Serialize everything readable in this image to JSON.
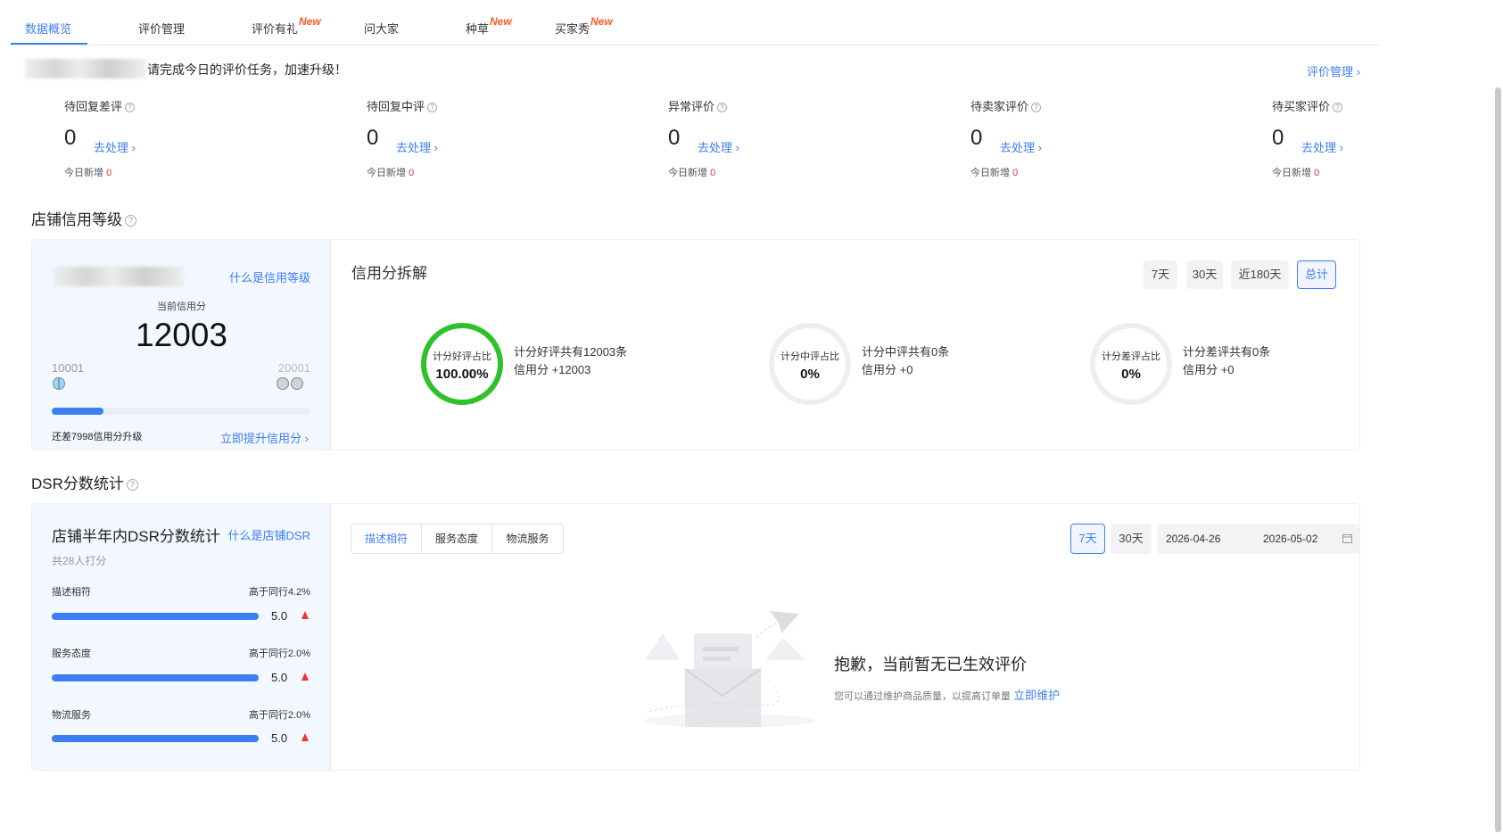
{
  "tabs": [
    {
      "label": "数据概览",
      "new": ""
    },
    {
      "label": "评价管理",
      "new": ""
    },
    {
      "label": "评价有礼",
      "new": "New"
    },
    {
      "label": "问大家",
      "new": ""
    },
    {
      "label": "种草",
      "new": "New"
    },
    {
      "label": "买家秀",
      "new": "New"
    }
  ],
  "header": {
    "hint": "请完成今日的评价任务，加速升级！",
    "eval_mgmt_link": "评价管理 ›"
  },
  "stats": [
    {
      "label": "待回复差评",
      "value": "0",
      "action": "去处理 ›",
      "today_label": "今日新增",
      "today_value": "0"
    },
    {
      "label": "待回复中评",
      "value": "0",
      "action": "去处理 ›",
      "today_label": "今日新增",
      "today_value": "0"
    },
    {
      "label": "异常评价",
      "value": "0",
      "action": "去处理 ›",
      "today_label": "今日新增",
      "today_value": "0"
    },
    {
      "label": "待卖家评价",
      "value": "0",
      "action": "去处理 ›",
      "today_label": "今日新增",
      "today_value": "0"
    },
    {
      "label": "待买家评价",
      "value": "0",
      "action": "去处理 ›",
      "today_label": "今日新增",
      "today_value": "0"
    }
  ],
  "credit": {
    "section_title": "店铺信用等级",
    "what_link": "什么是信用等级",
    "current_label": "当前信用分",
    "score": "12003",
    "min": "10001",
    "max": "20001",
    "progress": 0.2,
    "remaining": "还差7998信用分升级",
    "improve_link": "立即提升信用分 ›",
    "breakdown_title": "信用分拆解",
    "ranges": [
      "7天",
      "30天",
      "近180天",
      "总计"
    ],
    "active_range": "总计",
    "rings": [
      {
        "label": "计分好评占比",
        "value": "100.00%",
        "line1": "计分好评共有12003条",
        "line2": "信用分 +12003"
      },
      {
        "label": "计分中评占比",
        "value": "0%",
        "line1": "计分中评共有0条",
        "line2": "信用分 +0"
      },
      {
        "label": "计分差评占比",
        "value": "0%",
        "line1": "计分差评共有0条",
        "line2": "信用分 +0"
      }
    ]
  },
  "dsr": {
    "section_title": "DSR分数统计",
    "panel_title": "店铺半年内DSR分数统计",
    "what_link": "什么是店铺DSR",
    "count": "共28人打分",
    "rows": [
      {
        "label": "描述相符",
        "compare": "高于同行4.2%",
        "score": "5.0",
        "fill": 1.0
      },
      {
        "label": "服务态度",
        "compare": "高于同行2.0%",
        "score": "5.0",
        "fill": 1.0
      },
      {
        "label": "物流服务",
        "compare": "高于同行2.0%",
        "score": "5.0",
        "fill": 1.0
      }
    ],
    "segments": [
      "描述相符",
      "服务态度",
      "物流服务"
    ],
    "active_segment": "描述相符",
    "ranges": [
      "7天",
      "30天"
    ],
    "active_range": "7天",
    "date_start": "2026-04-26",
    "date_end": "2026-05-02",
    "empty_title": "抱歉，当前暂无已生效评价",
    "empty_desc": "您可以通过维护商品质量，以提高订单量",
    "empty_link": "立即维护"
  },
  "colors": {
    "accent": "#3d7ff2",
    "good": "#2fc12b",
    "alert": "#ee3333",
    "new_badge": "#ff5a1f"
  }
}
